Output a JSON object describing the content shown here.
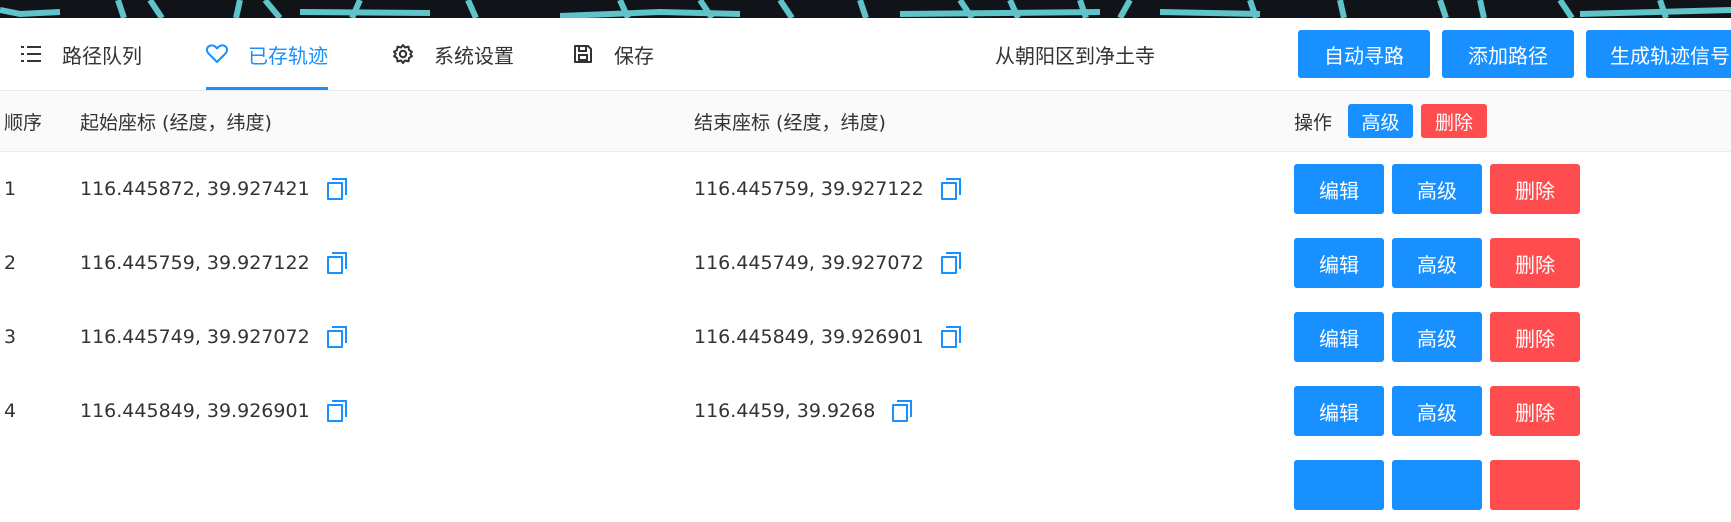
{
  "header": {
    "tabs": [
      {
        "label": "路径队列",
        "icon": "list-icon"
      },
      {
        "label": "已存轨迹",
        "icon": "heart-icon",
        "active": true
      },
      {
        "label": "系统设置",
        "icon": "gear-icon"
      },
      {
        "label": "保存",
        "icon": "save-icon"
      }
    ],
    "route_title": "从朝阳区到净土寺",
    "buttons": {
      "auto_route": "自动寻路",
      "add_route": "添加路径",
      "generate_signal": "生成轨迹信号"
    }
  },
  "table": {
    "columns": {
      "order": "顺序",
      "start": "起始座标 (经度，纬度)",
      "end": "结束座标 (经度，纬度)",
      "actions": "操作"
    },
    "header_buttons": {
      "advanced": "高级",
      "delete": "删除"
    },
    "row_buttons": {
      "edit": "编辑",
      "advanced": "高级",
      "delete": "删除"
    },
    "rows": [
      {
        "order": "1",
        "start": "116.445872, 39.927421",
        "end": "116.445759, 39.927122"
      },
      {
        "order": "2",
        "start": "116.445759, 39.927122",
        "end": "116.445749, 39.927072"
      },
      {
        "order": "3",
        "start": "116.445749, 39.927072",
        "end": "116.445849, 39.926901"
      },
      {
        "order": "4",
        "start": "116.445849, 39.926901",
        "end": "116.4459, 39.9268"
      },
      {
        "order": "",
        "start": "",
        "end": ""
      }
    ]
  },
  "colors": {
    "primary": "#1890ff",
    "danger": "#ff4d4f",
    "map_road": "#5fc4c9"
  }
}
